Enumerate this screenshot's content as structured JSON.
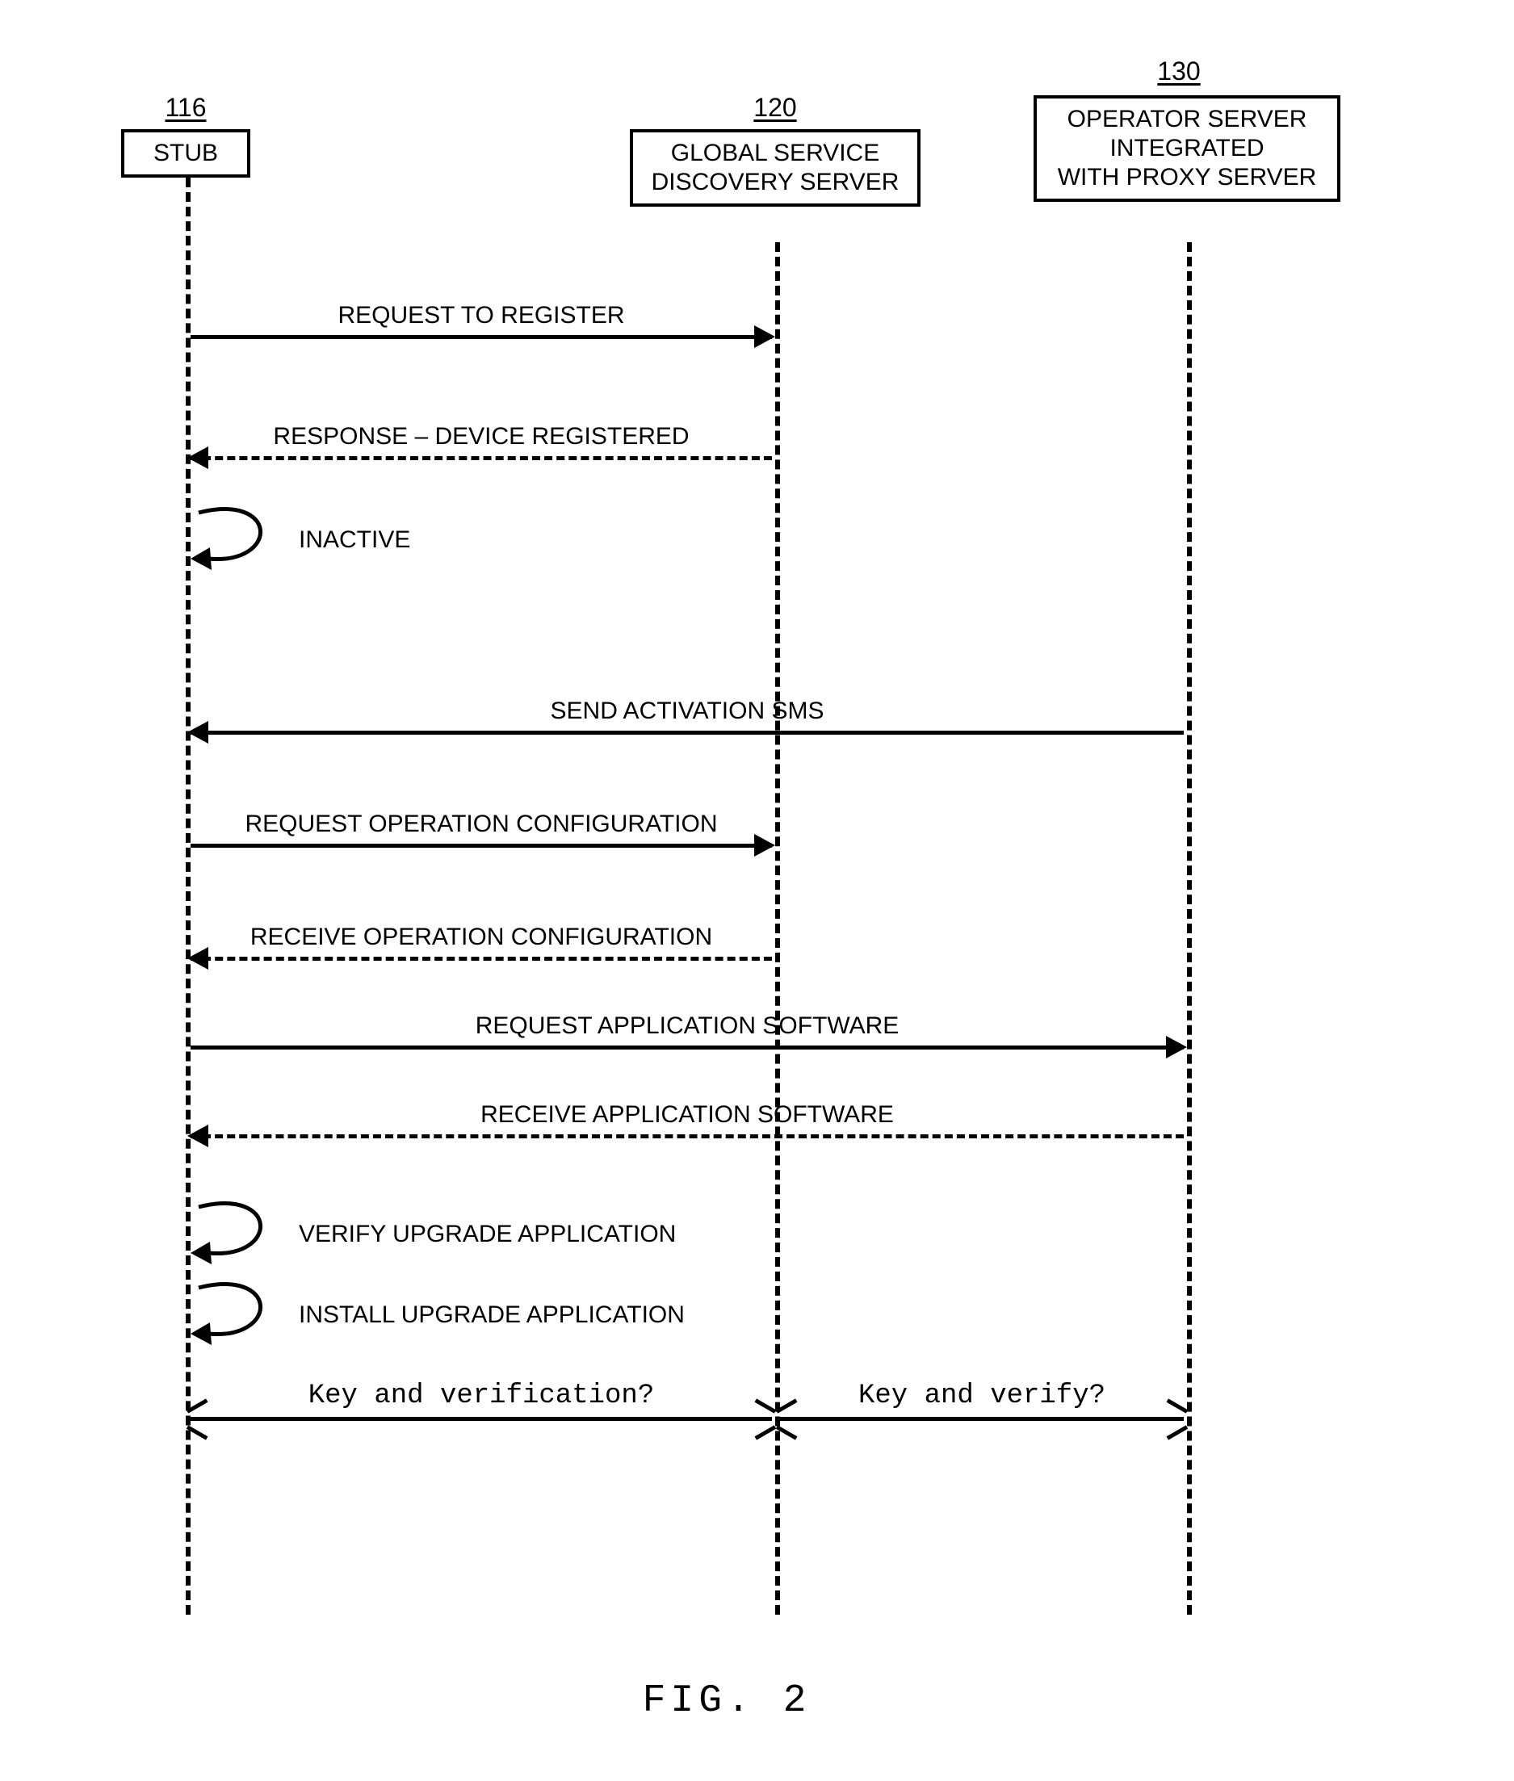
{
  "participants": {
    "stub": {
      "num": "116",
      "label": "STUB"
    },
    "gsd": {
      "num": "120",
      "label": "GLOBAL SERVICE\nDISCOVERY SERVER"
    },
    "ops": {
      "num": "130",
      "label": "OPERATOR SERVER\nINTEGRATED\nWITH PROXY SERVER"
    }
  },
  "messages": {
    "m1": "REQUEST TO REGISTER",
    "m2": "RESPONSE – DEVICE REGISTERED",
    "m3": "INACTIVE",
    "m4": "SEND ACTIVATION SMS",
    "m5": "REQUEST OPERATION CONFIGURATION",
    "m6": "RECEIVE OPERATION CONFIGURATION",
    "m7": "REQUEST APPLICATION SOFTWARE",
    "m8": "RECEIVE APPLICATION SOFTWARE",
    "m9": "VERIFY UPGRADE APPLICATION",
    "m10": "INSTALL UPGRADE APPLICATION",
    "m11": "Key and verification?",
    "m12": "Key and verify?"
  },
  "figure_label": "FIG. 2"
}
